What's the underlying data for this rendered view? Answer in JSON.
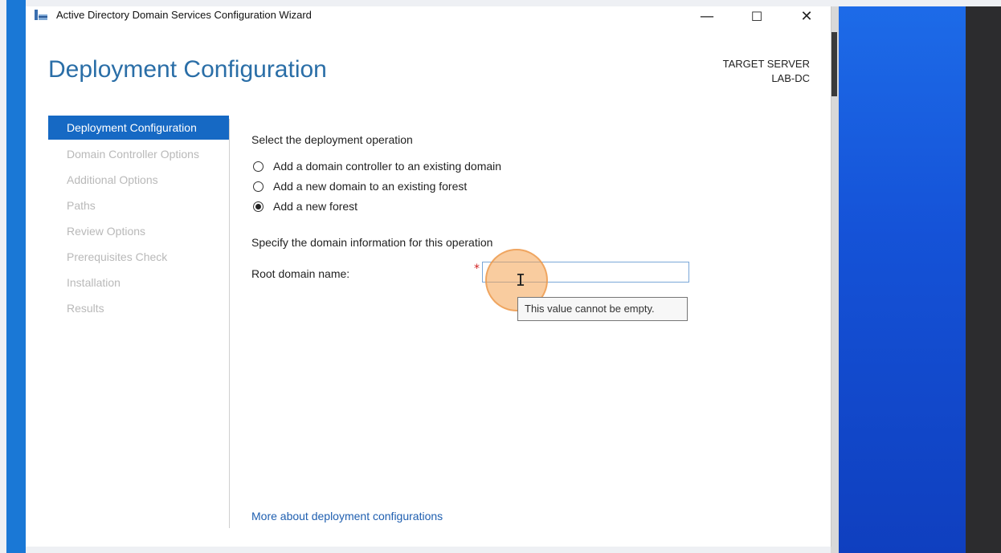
{
  "window": {
    "title": "Active Directory Domain Services Configuration Wizard",
    "controls": {
      "minimize": "—",
      "maximize": "☐",
      "close": "✕"
    }
  },
  "header": {
    "page_title": "Deployment Configuration",
    "target_server_label": "TARGET SERVER",
    "target_server_name": "LAB-DC"
  },
  "nav": {
    "items": [
      {
        "label": "Deployment Configuration",
        "active": true
      },
      {
        "label": "Domain Controller Options",
        "active": false
      },
      {
        "label": "Additional Options",
        "active": false
      },
      {
        "label": "Paths",
        "active": false
      },
      {
        "label": "Review Options",
        "active": false
      },
      {
        "label": "Prerequisites Check",
        "active": false
      },
      {
        "label": "Installation",
        "active": false
      },
      {
        "label": "Results",
        "active": false
      }
    ]
  },
  "main": {
    "operation_heading": "Select the deployment operation",
    "options": [
      {
        "label": "Add a domain controller to an existing domain",
        "checked": false
      },
      {
        "label": "Add a new domain to an existing forest",
        "checked": false
      },
      {
        "label": "Add a new forest",
        "checked": true
      }
    ],
    "domain_heading": "Specify the domain information for this operation",
    "root_domain_label": "Root domain name:",
    "required_marker": "*",
    "root_domain_value": "",
    "validation_tooltip": "This value cannot be empty.",
    "more_link": "More about deployment configurations"
  },
  "colors": {
    "accent": "#1669c4",
    "heading": "#2a6ea7",
    "desktop": "#1553d8"
  },
  "icons": {
    "app": "ad-ds-wizard-icon",
    "cursor": "text-ibeam-cursor"
  }
}
